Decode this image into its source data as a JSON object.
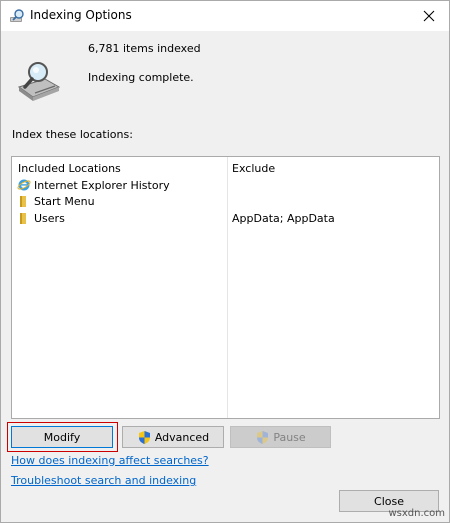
{
  "window": {
    "title": "Indexing Options",
    "title_icon": "search-magnifier-icon",
    "close_icon": "close-icon"
  },
  "summary": {
    "items_indexed": "6,781 items indexed",
    "status": "Indexing complete."
  },
  "locations": {
    "section_label": "Index these locations:",
    "headers": {
      "included": "Included Locations",
      "exclude": "Exclude"
    },
    "rows": [
      {
        "label": "Internet Explorer History",
        "exclude": "",
        "icon": "internet-explorer-icon"
      },
      {
        "label": "Start Menu",
        "exclude": "",
        "icon": "folder-icon"
      },
      {
        "label": "Users",
        "exclude": "AppData; AppData",
        "icon": "folder-icon"
      }
    ]
  },
  "buttons": {
    "modify": "Modify",
    "advanced": "Advanced",
    "pause": "Pause",
    "close": "Close"
  },
  "links": {
    "how_affects": "How does indexing affect searches?",
    "troubleshoot": "Troubleshoot search and indexing"
  },
  "watermark": "wsxdn.com",
  "colors": {
    "accent": "#0078d7",
    "link": "#0066cc",
    "highlight": "#cc0000",
    "folder": "#e8c14a"
  }
}
